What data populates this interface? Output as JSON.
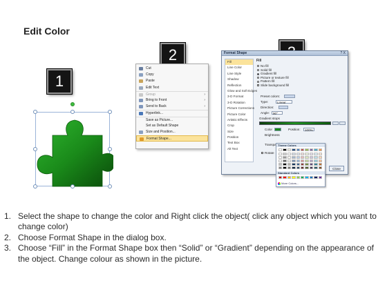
{
  "title": "Edit Color",
  "badges": [
    "1",
    "2",
    "3"
  ],
  "context_menu": {
    "items": [
      {
        "label": "Cut",
        "icon": "scissors-icon",
        "disabled": false,
        "submenu": false,
        "active": false
      },
      {
        "label": "Copy",
        "icon": "copy-icon",
        "disabled": false,
        "submenu": false,
        "active": false
      },
      {
        "label": "Paste",
        "icon": "paste-icon",
        "disabled": false,
        "submenu": false,
        "active": false
      },
      {
        "label": "Edit Text",
        "icon": "edit-text-icon",
        "disabled": false,
        "submenu": false,
        "active": false
      },
      {
        "label": "Group",
        "icon": "group-icon",
        "disabled": true,
        "submenu": true,
        "active": false
      },
      {
        "label": "Bring to Front",
        "icon": "bring-front-icon",
        "disabled": false,
        "submenu": true,
        "active": false
      },
      {
        "label": "Send to Back",
        "icon": "send-back-icon",
        "disabled": false,
        "submenu": true,
        "active": false
      },
      {
        "label": "Hyperlink...",
        "icon": "hyperlink-icon",
        "disabled": false,
        "submenu": false,
        "active": false
      },
      {
        "label": "Save as Picture...",
        "icon": "",
        "disabled": false,
        "submenu": false,
        "active": false
      },
      {
        "label": "Set as Default Shape",
        "icon": "",
        "disabled": false,
        "submenu": false,
        "active": false
      },
      {
        "label": "Size and Position...",
        "icon": "size-icon",
        "disabled": false,
        "submenu": false,
        "active": false
      },
      {
        "label": "Format Shape...",
        "icon": "format-shape-icon",
        "disabled": false,
        "submenu": false,
        "active": true
      }
    ]
  },
  "dialog": {
    "title": "Format Shape",
    "title_buttons": "? X",
    "nav": [
      "Fill",
      "Line Color",
      "Line Style",
      "Shadow",
      "Reflection",
      "Glow and Soft Edges",
      "3-D Format",
      "3-D Rotation",
      "Picture Corrections",
      "Picture Color",
      "Artistic Effects",
      "Crop",
      "Size",
      "Position",
      "Text Box",
      "Alt Text"
    ],
    "fill_heading": "Fill",
    "fill_options": [
      {
        "label": "No fill",
        "selected": false
      },
      {
        "label": "Solid fill",
        "selected": false
      },
      {
        "label": "Gradient fill",
        "selected": true
      },
      {
        "label": "Picture or texture fill",
        "selected": false
      },
      {
        "label": "Pattern fill",
        "selected": false
      }
    ],
    "slide_background": "Slide background fill",
    "preset_colors_label": "Preset colors:",
    "type_label": "Type:",
    "type_value": "Linear",
    "direction_label": "Direction:",
    "angle_label": "Angle:",
    "angle_value": "90°",
    "gradient_stops_label": "Gradient stops",
    "color_label": "Color",
    "position_label": "Position:",
    "position_value": "100%",
    "brightness_label": "Brightness",
    "transparency_label": "Transpare",
    "rotate_label": "Rotate",
    "close_label": "Close"
  },
  "palette": {
    "theme_label": "Theme Colors",
    "standard_label": "Standard Colors",
    "more_label": "More Colors...",
    "theme_colors": [
      "#ffffff",
      "#000000",
      "#eeece1",
      "#1f497d",
      "#4f81bd",
      "#c0504d",
      "#9bbb59",
      "#8064a2",
      "#4bacc6",
      "#f79646"
    ],
    "standard_colors": [
      "#c00000",
      "#ff0000",
      "#ffc000",
      "#ffff00",
      "#92d050",
      "#00b050",
      "#00b0f0",
      "#0070c0",
      "#002060",
      "#7030a0"
    ]
  },
  "steps": [
    {
      "num": "1.",
      "text": "Select the shape to change the color and Right click the object( click any object which you want to change color)"
    },
    {
      "num": "2.",
      "text": "Choose Format Shape in the dialog box."
    },
    {
      "num": "3.",
      "text": "Choose “Fill” in the Format Shape box then “Solid” or “Gradient” depending on the appearance of the object. Change colour as shown in the picture."
    }
  ],
  "colors": {
    "puzzle_dark": "#0a4a0a",
    "puzzle_mid": "#1a8a1a",
    "puzzle_light": "#2fb52f",
    "menu_highlight": "#fbe39b"
  }
}
